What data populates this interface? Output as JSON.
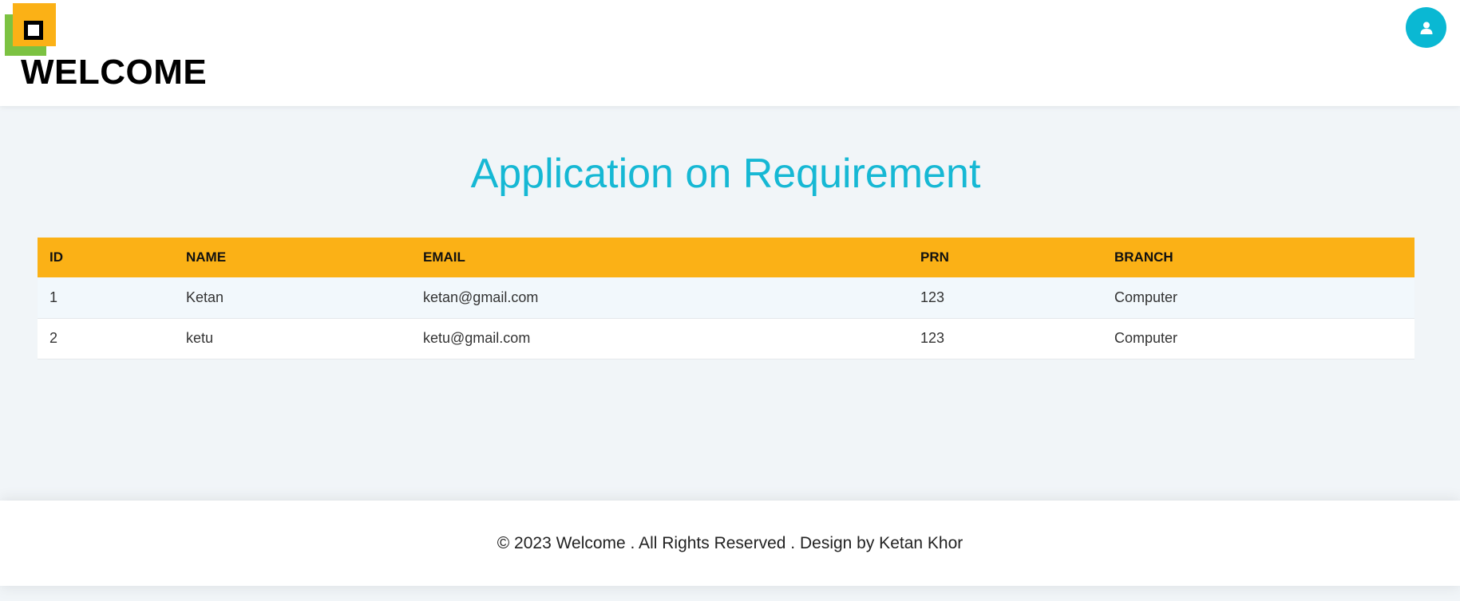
{
  "header": {
    "brand": "WELCOME",
    "logo_icon": "logo-squares",
    "user_icon": "user-icon",
    "colors": {
      "logo_green": "#7cc242",
      "logo_orange": "#fbb116",
      "accent": "#0ab8d3"
    }
  },
  "main": {
    "title": "Application on Requirement",
    "table": {
      "columns": [
        "ID",
        "NAME",
        "EMAIL",
        "PRN",
        "BRANCH"
      ],
      "rows": [
        [
          "1",
          "Ketan",
          "ketan@gmail.com",
          "123",
          "Computer"
        ],
        [
          "2",
          "ketu",
          "ketu@gmail.com",
          "123",
          "Computer"
        ]
      ],
      "header_color": "#fbb116"
    }
  },
  "footer": {
    "text": "© 2023 Welcome . All Rights Reserved . Design by Ketan Khor"
  }
}
